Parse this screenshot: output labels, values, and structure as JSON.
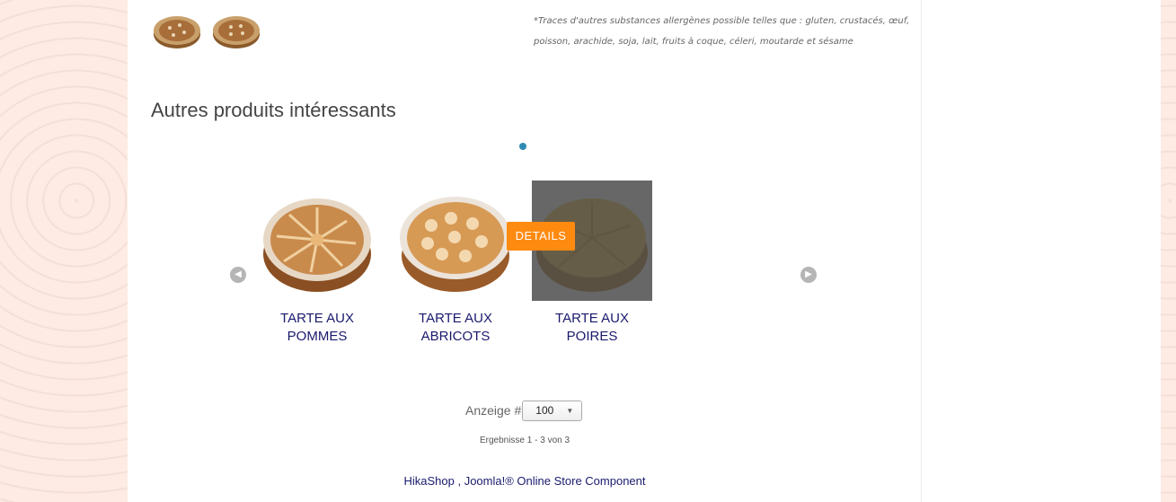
{
  "allergen_note": "*Traces d'autres substances allergènes possible telles que : gluten, crustacés, œuf, poisson, arachide, soja, lait, fruits à coque, céleri, moutarde et sésame",
  "related": {
    "title": "Autres produits intéressants",
    "details_label": "DETAILS",
    "products": [
      {
        "name": "TARTE AUX POMMES"
      },
      {
        "name": "TARTE AUX ABRICOTS"
      },
      {
        "name": "TARTE AUX POIRES"
      }
    ]
  },
  "pagination": {
    "limit_label": "Anzeige #",
    "limit_value": "100",
    "result_text": "Ergebnisse 1 - 3 von 3"
  },
  "footer": {
    "link_text": "HikaShop , Joomla!® Online Store Component"
  },
  "icons": {
    "prev": "chevron-left-icon",
    "next": "chevron-right-icon"
  },
  "colors": {
    "accent_button": "#ff8a10",
    "link": "#1a1a6e",
    "pager_dot": "#2f8bb3"
  }
}
